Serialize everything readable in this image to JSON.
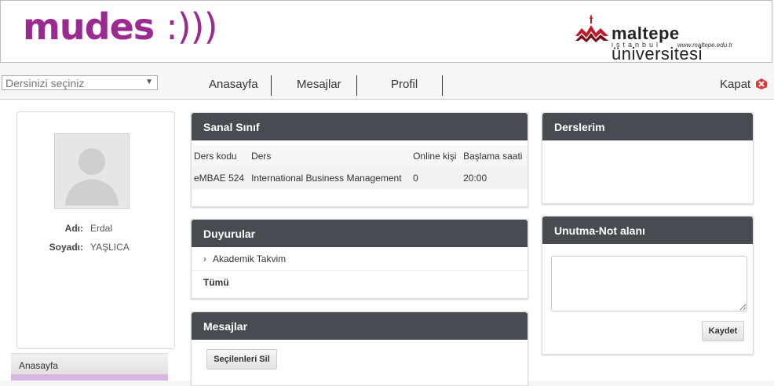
{
  "header": {
    "logo_text": "mudes",
    "logo_suffix": ":)))",
    "university": {
      "name_bold": "maltepe",
      "name_light": "üniversitesi",
      "city": "istanbul",
      "website": "www.maltepe.edu.tr"
    }
  },
  "course_select": {
    "placeholder": "Dersinizi seçiniz"
  },
  "nav": {
    "items": [
      "Anasayfa",
      "Mesajlar",
      "Profil"
    ]
  },
  "logout": {
    "label": "Kapat"
  },
  "profile": {
    "name_label": "Adı:",
    "name_value": "Erdal",
    "surname_label": "Soyadı:",
    "surname_value": "YAŞLICA"
  },
  "side_menu": {
    "items": [
      "Anasayfa"
    ]
  },
  "virtual_class": {
    "title": "Sanal Sınıf",
    "columns": [
      "Ders kodu",
      "Ders",
      "Online kişi",
      "Başlama saati"
    ],
    "rows": [
      [
        "eMBAE 524",
        "International Business Management",
        "0",
        "20:00"
      ]
    ]
  },
  "announcements": {
    "title": "Duyurular",
    "items": [
      "Akademik Takvim"
    ],
    "all_label": "Tümü"
  },
  "messages": {
    "title": "Mesajlar",
    "delete_button": "Seçilenleri Sil"
  },
  "courses": {
    "title": "Derslerim"
  },
  "notes": {
    "title": "Unutma-Not alanı",
    "save_button": "Kaydet"
  },
  "colors": {
    "brand_purple": "#9a2a8f",
    "panel_header": "#4a4b50",
    "maltepe_red": "#c0192b"
  }
}
